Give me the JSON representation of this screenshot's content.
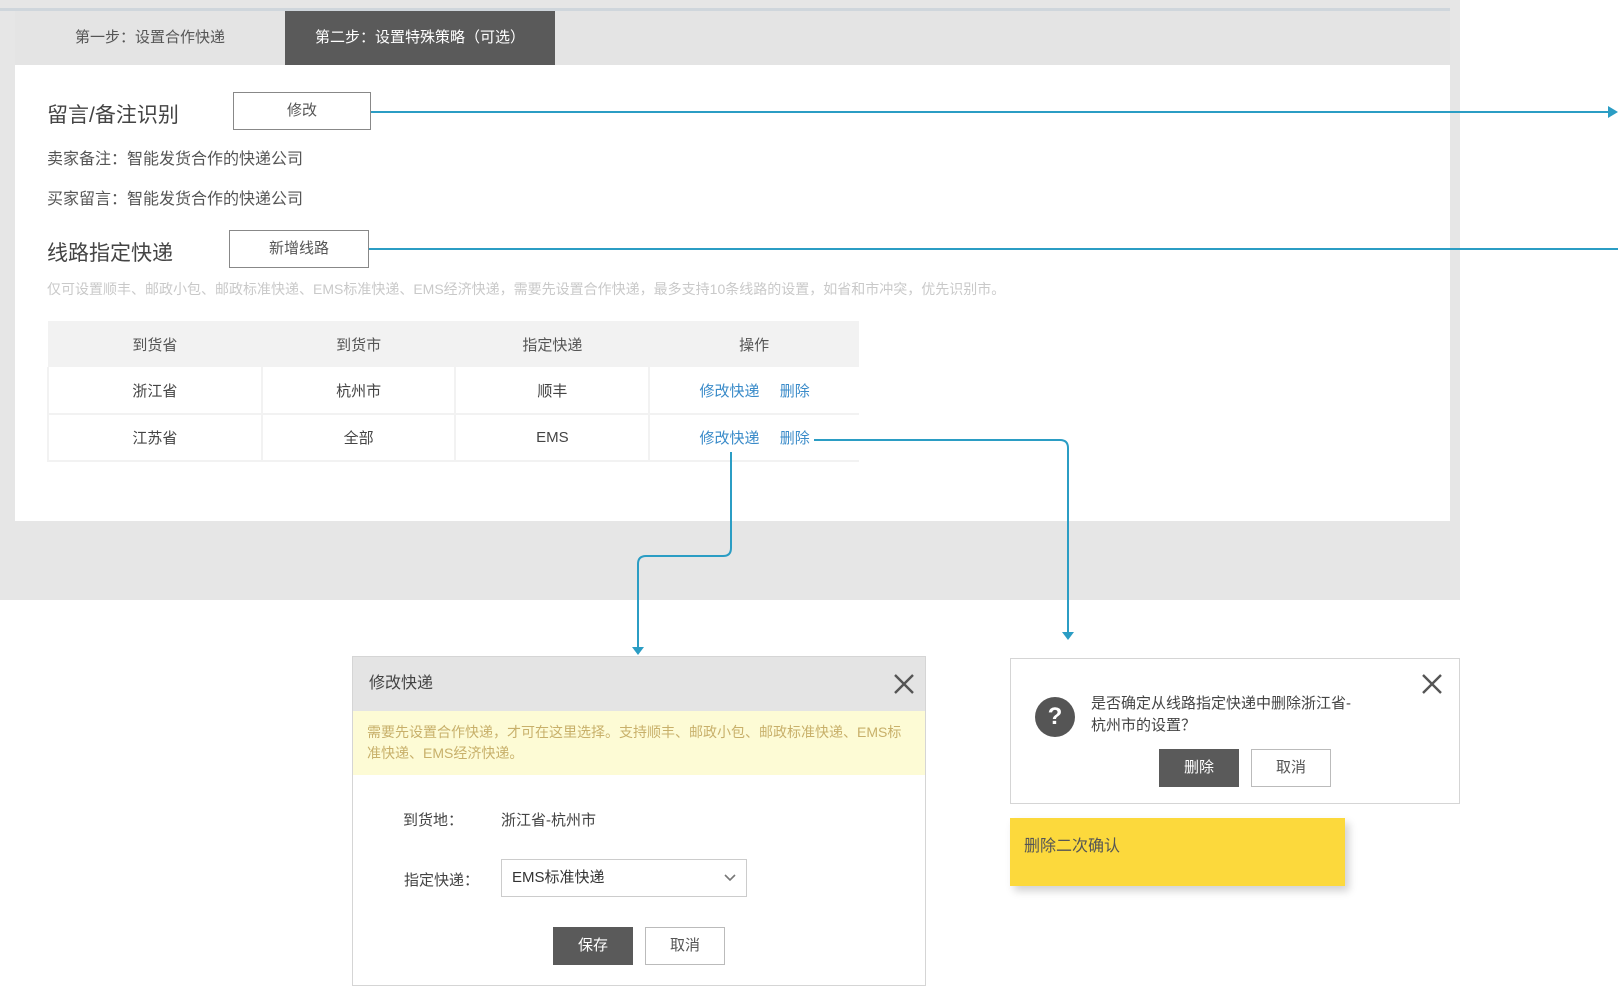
{
  "tabs": [
    {
      "label": "第一步：设置合作快递"
    },
    {
      "label": "第二步：设置特殊策略（可选）"
    }
  ],
  "message_section": {
    "title": "留言/备注识别",
    "edit_button": "修改",
    "seller_note": "卖家备注：智能发货合作的快递公司",
    "buyer_message": "买家留言：智能发货合作的快递公司"
  },
  "route_section": {
    "title": "线路指定快递",
    "add_button": "新增线路",
    "hint": "仅可设置顺丰、邮政小包、邮政标准快递、EMS标准快递、EMS经济快递，需要先设置合作快递，最多支持10条线路的设置，如省和市冲突，优先识别市。"
  },
  "table": {
    "headers": [
      "到货省",
      "到货市",
      "指定快递",
      "操作"
    ],
    "rows": [
      {
        "province": "浙江省",
        "city": "杭州市",
        "carrier": "顺丰",
        "edit": "修改快递",
        "delete": "删除"
      },
      {
        "province": "江苏省",
        "city": "全部",
        "carrier": "EMS",
        "edit": "修改快递",
        "delete": "删除"
      }
    ]
  },
  "edit_dialog": {
    "title": "修改快递",
    "notice": "需要先设置合作快递，才可在这里选择。支持顺丰、邮政小包、邮政标准快递、EMS标准快递、EMS经济快递。",
    "destination_label": "到货地：",
    "destination_value": "浙江省-杭州市",
    "carrier_label": "指定快递：",
    "carrier_value": "EMS标准快递",
    "save_button": "保存",
    "cancel_button": "取消"
  },
  "confirm_dialog": {
    "icon": "?",
    "message": "是否确定从线路指定快递中删除浙江省-杭州市的设置？",
    "delete_button": "删除",
    "cancel_button": "取消"
  },
  "sticky_note": {
    "text": "删除二次确认"
  },
  "colors": {
    "connector": "#2b9dc4",
    "active_tab": "#5a5a5a",
    "link": "#3a8bc9",
    "note": "#fcd93c"
  }
}
